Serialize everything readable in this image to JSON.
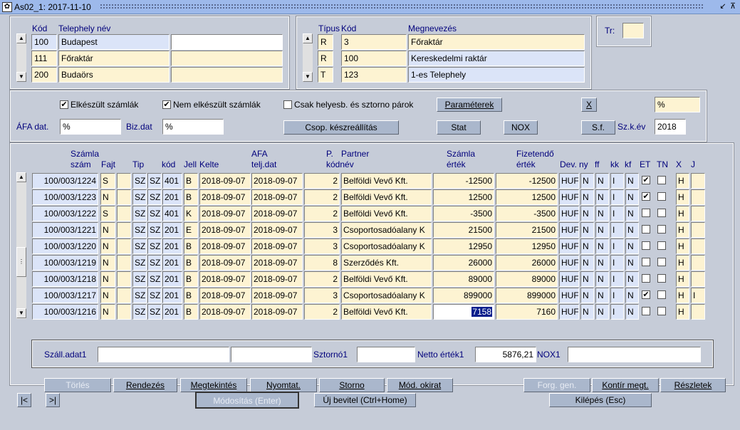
{
  "window": {
    "title": "As02_1: 2017-11-10"
  },
  "telephely": {
    "headers": {
      "kod": "Kód",
      "nev": "Telephely név"
    },
    "rows": [
      {
        "kod": "100",
        "nev": "Budapest",
        "extra": ""
      },
      {
        "kod": "111",
        "nev": "Főraktár",
        "extra": ""
      },
      {
        "kod": "200",
        "nev": "Budaörs",
        "extra": ""
      }
    ]
  },
  "tipus": {
    "headers": {
      "tipus": "Típus",
      "kod": "Kód",
      "megnevezes": "Megnevezés"
    },
    "rows": [
      {
        "tipus": "R",
        "kod": "3",
        "megnevezes": "Főraktár"
      },
      {
        "tipus": "R",
        "kod": "100",
        "megnevezes": "Kereskedelmi raktár"
      },
      {
        "tipus": "T",
        "kod": "123",
        "megnevezes": "1-es Telephely"
      }
    ]
  },
  "tr": {
    "label": "Tr:",
    "value": ""
  },
  "filters": {
    "elkeszult": {
      "label": "Elkészült számlák",
      "checked": true
    },
    "nem_elkeszult": {
      "label": "Nem elkészült számlák",
      "checked": true
    },
    "csak_helyesb": {
      "label": "Csak helyesb. és sztorno párok",
      "checked": false
    },
    "parameterek": "Paraméterek",
    "x_button": "X",
    "percent_field": "%",
    "afa_dat_label": "ÁFA dat.",
    "afa_dat_value": "%",
    "biz_dat_label": "Biz.dat",
    "biz_dat_value": "%",
    "csop_keszreallitas": "Csop. készreállítás",
    "stat": "Stat",
    "nox": "NOX",
    "sf": "S.f.",
    "szk_ev_label": "Sz.k.év",
    "szk_ev_value": "2018"
  },
  "grid": {
    "headers": {
      "szamla_szam_1": "Számla",
      "szamla_szam_2": "szám",
      "fajt": "Fajt",
      "tip": "Tip",
      "kod": "kód",
      "jell": "Jell",
      "kelte": "Kelte",
      "afa_1": "AFA",
      "afa_2": "telj.dat",
      "p_1": "P.",
      "p_2": "kódnév",
      "partner": "Partner",
      "szamla_ertek_1": "Számla",
      "szamla_ertek_2": "érték",
      "fizetendo_1": "Fizetendő",
      "fizetendo_2": "érték",
      "dev": "Dev.",
      "ny": "ny",
      "ff": "ff",
      "kk": "kk",
      "kf": "kf",
      "et": "ET",
      "tn": "TN",
      "x": "X",
      "j": "J"
    },
    "rows": [
      {
        "szam": "100/003/1224",
        "fajt": "S",
        "tip1": "SZ",
        "tip2": "SZ",
        "kod": "401",
        "jell": "B",
        "kelte": "2018-09-07",
        "afa": "2018-09-07",
        "p": "2",
        "partner": "Belföldi Vevő Kft.",
        "ertek": "-12500",
        "fizet": "-12500",
        "dev": "HUF",
        "ny": "N",
        "ff": "N",
        "kk": "I",
        "kf": "N",
        "et": true,
        "tn": false,
        "x": "H",
        "j": ""
      },
      {
        "szam": "100/003/1223",
        "fajt": "N",
        "tip1": "SZ",
        "tip2": "SZ",
        "kod": "201",
        "jell": "B",
        "kelte": "2018-09-07",
        "afa": "2018-09-07",
        "p": "2",
        "partner": "Belföldi Vevő Kft.",
        "ertek": "12500",
        "fizet": "12500",
        "dev": "HUF",
        "ny": "N",
        "ff": "N",
        "kk": "I",
        "kf": "N",
        "et": true,
        "tn": false,
        "x": "H",
        "j": ""
      },
      {
        "szam": "100/003/1222",
        "fajt": "S",
        "tip1": "SZ",
        "tip2": "SZ",
        "kod": "401",
        "jell": "K",
        "kelte": "2018-09-07",
        "afa": "2018-09-07",
        "p": "2",
        "partner": "Belföldi Vevő Kft.",
        "ertek": "-3500",
        "fizet": "-3500",
        "dev": "HUF",
        "ny": "N",
        "ff": "N",
        "kk": "I",
        "kf": "N",
        "et": false,
        "tn": false,
        "x": "H",
        "j": ""
      },
      {
        "szam": "100/003/1221",
        "fajt": "N",
        "tip1": "SZ",
        "tip2": "SZ",
        "kod": "201",
        "jell": "E",
        "kelte": "2018-09-07",
        "afa": "2018-09-07",
        "p": "3",
        "partner": "Csoportosadóalany K",
        "ertek": "21500",
        "fizet": "21500",
        "dev": "HUF",
        "ny": "N",
        "ff": "N",
        "kk": "I",
        "kf": "N",
        "et": false,
        "tn": false,
        "x": "H",
        "j": ""
      },
      {
        "szam": "100/003/1220",
        "fajt": "N",
        "tip1": "SZ",
        "tip2": "SZ",
        "kod": "201",
        "jell": "B",
        "kelte": "2018-09-07",
        "afa": "2018-09-07",
        "p": "3",
        "partner": "Csoportosadóalany K",
        "ertek": "12950",
        "fizet": "12950",
        "dev": "HUF",
        "ny": "N",
        "ff": "N",
        "kk": "I",
        "kf": "N",
        "et": false,
        "tn": false,
        "x": "H",
        "j": ""
      },
      {
        "szam": "100/003/1219",
        "fajt": "N",
        "tip1": "SZ",
        "tip2": "SZ",
        "kod": "201",
        "jell": "B",
        "kelte": "2018-09-07",
        "afa": "2018-09-07",
        "p": "8",
        "partner": "Szerződés Kft.",
        "ertek": "26000",
        "fizet": "26000",
        "dev": "HUF",
        "ny": "N",
        "ff": "N",
        "kk": "I",
        "kf": "N",
        "et": false,
        "tn": false,
        "x": "H",
        "j": ""
      },
      {
        "szam": "100/003/1218",
        "fajt": "N",
        "tip1": "SZ",
        "tip2": "SZ",
        "kod": "201",
        "jell": "B",
        "kelte": "2018-09-07",
        "afa": "2018-09-07",
        "p": "2",
        "partner": "Belföldi Vevő Kft.",
        "ertek": "89000",
        "fizet": "89000",
        "dev": "HUF",
        "ny": "N",
        "ff": "N",
        "kk": "I",
        "kf": "N",
        "et": false,
        "tn": false,
        "x": "H",
        "j": ""
      },
      {
        "szam": "100/003/1217",
        "fajt": "N",
        "tip1": "SZ",
        "tip2": "SZ",
        "kod": "201",
        "jell": "B",
        "kelte": "2018-09-07",
        "afa": "2018-09-07",
        "p": "3",
        "partner": "Csoportosadóalany K",
        "ertek": "899000",
        "fizet": "899000",
        "dev": "HUF",
        "ny": "N",
        "ff": "N",
        "kk": "I",
        "kf": "N",
        "et": true,
        "tn": false,
        "x": "H",
        "j": "I"
      },
      {
        "szam": "100/003/1216",
        "fajt": "N",
        "tip1": "SZ",
        "tip2": "SZ",
        "kod": "201",
        "jell": "B",
        "kelte": "2018-09-07",
        "afa": "2018-09-07",
        "p": "2",
        "partner": "Belföldi Vevő Kft.",
        "ertek": "7158",
        "fizet": "7160",
        "dev": "HUF",
        "ny": "N",
        "ff": "N",
        "kk": "I",
        "kf": "N",
        "et": false,
        "tn": false,
        "x": "H",
        "j": ""
      }
    ]
  },
  "details": {
    "szall_adat1": "Száll.adat1",
    "sztorno1": "Sztornó1",
    "netto_ertek1": "Netto érték1",
    "netto_value": "5876,21",
    "nox1": "NOX1"
  },
  "actions": {
    "torles": "Törlés",
    "rendezes": "Rendezés",
    "megtekintes": "Megtekintés",
    "nyomtat": "Nyomtat.",
    "storno": "Storno",
    "mod_okirat": "Mód. okirat",
    "forg_gen": "Forg. gen.",
    "kontir_megt": "Kontír megt.",
    "reszletek": "Részletek"
  },
  "footer": {
    "first": "|<",
    "prev": ">|",
    "modositas": "Módosítás (Enter)",
    "uj_bevitel": "Új bevitel (Ctrl+Home)",
    "kilepes": "Kilépés (Esc)"
  }
}
